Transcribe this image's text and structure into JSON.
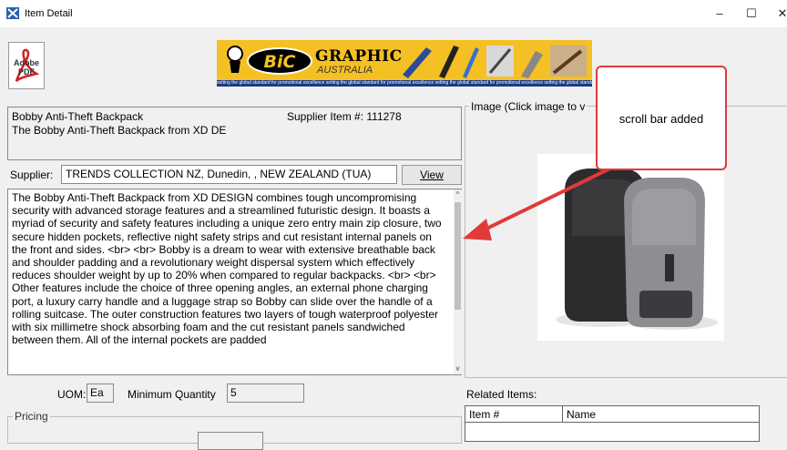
{
  "window": {
    "title": "Item Detail",
    "controls": {
      "minimize": "–",
      "maximize": "☐",
      "close": "✕"
    }
  },
  "logos": {
    "pdf_label": "Adobe PDF",
    "bic_word": "BiC",
    "bic_graphic": "GRAPHIC",
    "bic_australia": "AUSTRALIA",
    "bic_strip": "setting the global standard for promotional excellence  setting the global standard for promotional excellence  setting the global standard for promotional excellence  setting the global standard for promotional excellence"
  },
  "item": {
    "name": "Bobby Anti-Theft Backpack",
    "supplier_item": "Supplier Item #: 111278",
    "subtitle": "The Bobby Anti-Theft Backpack from XD DE"
  },
  "supplier": {
    "label": "Supplier:",
    "value": "TRENDS COLLECTION NZ, Dunedin, , NEW ZEALAND (TUA)",
    "view_button": "View"
  },
  "description": "The Bobby Anti-Theft Backpack from XD DESIGN combines tough uncompromising security with advanced storage features and a streamlined futuristic design. It boasts a myriad of security and safety features including a unique zero entry main zip closure, two secure hidden pockets, reflective night safety strips and cut resistant internal panels on the front and sides. <br> <br> Bobby is a dream to wear with extensive breathable back and shoulder padding and a revolutionary weight dispersal system which effectively reduces shoulder weight by up to 20% when compared to regular backpacks. <br> <br> Other features include the choice of three opening angles, an external phone charging port, a luxury carry handle and a luggage strap so Bobby can slide over the handle of a rolling suitcase. The outer construction features two layers of tough waterproof polyester with six millimetre shock absorbing foam and the cut resistant panels sandwiched between them. All of the internal pockets are padded",
  "uom": {
    "label": "UOM:",
    "value": "Ea"
  },
  "min_quantity": {
    "label": "Minimum Quantity",
    "value": "5"
  },
  "pricing": {
    "legend": "Pricing"
  },
  "image_panel": {
    "legend": "Image (Click image to v"
  },
  "related": {
    "label": "Related Items:",
    "columns": [
      "Item #",
      "Name"
    ]
  },
  "annotation": {
    "text": "scroll bar added",
    "border_color": "#e03a3a",
    "arrow_color": "#e03a3a"
  },
  "icons": {
    "scroll_up": "^",
    "scroll_down": "v"
  }
}
